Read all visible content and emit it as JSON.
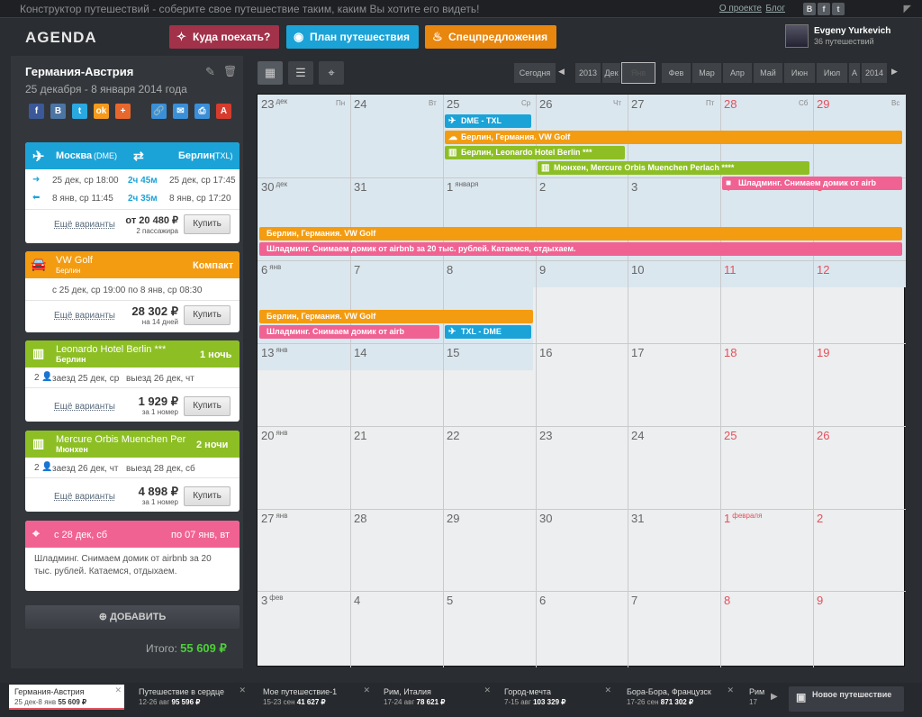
{
  "topbar": {
    "title": "Конструктор путешествий - соберите свое путешествие таким, каким Вы хотите его видеть!",
    "link_about": "О проекте",
    "link_blog": "Блог",
    "soc": [
      "В",
      "f",
      "t"
    ]
  },
  "header": {
    "logo": "AGENDA",
    "nav": [
      "Куда поехать?",
      "План путешествия",
      "Спецпредложения"
    ],
    "user_name": "Evgeny Yurkevich",
    "user_trips": "36 путешествий"
  },
  "trip": {
    "title": "Германия-Австрия",
    "dates": "25 декабря - 8 января 2014 года",
    "share": [
      "f",
      "B",
      "t",
      "ok",
      "+",
      "🔗",
      "✉",
      "⎙",
      "A"
    ]
  },
  "flight": {
    "from": "Москва",
    "from_code": "(DME)",
    "to": "Берлин",
    "to_code": "(TXL)",
    "leg1_dep": "25 дек, ср 18:00",
    "leg1_dur": "2ч 45м",
    "leg1_arr": "25 дек, ср 17:45",
    "leg2_dep": "8 янв, ср 11:45",
    "leg2_dur": "2ч 35м",
    "leg2_arr": "8 янв, ср 17:20",
    "more": "Ещё варианты",
    "price": "от 20 480 ₽",
    "price_sub": "2 пассажира",
    "buy": "Купить"
  },
  "car": {
    "name": "VW Golf",
    "city": "Берлин",
    "class": "Компакт",
    "period": "с 25 дек, ср 19:00 по 8 янв, ср 08:30",
    "more": "Ещё варианты",
    "price": "28 302 ₽",
    "price_sub": "на 14 дней",
    "buy": "Купить"
  },
  "hotel1": {
    "name": "Leonardo Hotel Berlin ***",
    "city": "Берлин",
    "nights": "1 ночь",
    "guests": "2",
    "checkin": "заезд 25 дек, ср",
    "checkout": "выезд 26 дек, чт",
    "more": "Ещё варианты",
    "price": "1 929 ₽",
    "price_sub": "за 1 номер",
    "buy": "Купить"
  },
  "hotel2": {
    "name": "Mercure Orbis Muenchen Per",
    "city": "Мюнхен",
    "nights": "2 ночи",
    "guests": "2",
    "checkin": "заезд 26 дек, чт",
    "checkout": "выезд 28 дек, сб",
    "more": "Ещё варианты",
    "price": "4 898 ₽",
    "price_sub": "за 1 номер",
    "buy": "Купить"
  },
  "rent": {
    "from": "с  28 дек, сб",
    "to": "по 07 янв, вт",
    "text": "Шладминг. Снимаем домик от airbnb за 20 тыс. рублей. Катаемся, отдыхаем."
  },
  "add_label": "ДОБАВИТЬ",
  "total_label": "Итого:",
  "total_value": "55 609 ₽",
  "calnav": {
    "today": "Сегодня",
    "year1": "2013",
    "months": [
      "Дек",
      "Янв",
      "Фев",
      "Мар",
      "Апр",
      "Май",
      "Июн",
      "Июл",
      "А"
    ],
    "year2": "2014",
    "prev": "◀",
    "next": "▶"
  },
  "weekdays": [
    "Пн",
    "Вт",
    "Ср",
    "Чт",
    "Пт",
    "Сб",
    "Вс"
  ],
  "weeks": [
    [
      [
        "23",
        "дек"
      ],
      [
        "24",
        ""
      ],
      [
        "25",
        ""
      ],
      [
        "26",
        ""
      ],
      [
        "27",
        ""
      ],
      [
        "28",
        ""
      ],
      [
        "29",
        ""
      ]
    ],
    [
      [
        "30",
        "дек"
      ],
      [
        "31",
        ""
      ],
      [
        "1",
        "января"
      ],
      [
        "2",
        ""
      ],
      [
        "3",
        ""
      ],
      [
        "4",
        ""
      ],
      [
        "5",
        ""
      ]
    ],
    [
      [
        "6",
        "янв"
      ],
      [
        "7",
        ""
      ],
      [
        "8",
        ""
      ],
      [
        "9",
        ""
      ],
      [
        "10",
        ""
      ],
      [
        "11",
        ""
      ],
      [
        "12",
        ""
      ]
    ],
    [
      [
        "13",
        "янв"
      ],
      [
        "14",
        ""
      ],
      [
        "15",
        ""
      ],
      [
        "16",
        ""
      ],
      [
        "17",
        ""
      ],
      [
        "18",
        ""
      ],
      [
        "19",
        ""
      ]
    ],
    [
      [
        "20",
        "янв"
      ],
      [
        "21",
        ""
      ],
      [
        "22",
        ""
      ],
      [
        "23",
        ""
      ],
      [
        "24",
        ""
      ],
      [
        "25",
        ""
      ],
      [
        "26",
        ""
      ]
    ],
    [
      [
        "27",
        "янв"
      ],
      [
        "28",
        ""
      ],
      [
        "29",
        ""
      ],
      [
        "30",
        ""
      ],
      [
        "31",
        ""
      ],
      [
        "1",
        "февраля"
      ],
      [
        "2",
        ""
      ]
    ],
    [
      [
        "3",
        "фев"
      ],
      [
        "4",
        ""
      ],
      [
        "5",
        ""
      ],
      [
        "6",
        ""
      ],
      [
        "7",
        ""
      ],
      [
        "8",
        ""
      ],
      [
        "9",
        ""
      ]
    ]
  ],
  "events": {
    "e1": "DME - TXL",
    "e2": "Берлин, Германия. VW Golf",
    "e3": "Берлин, Leonardo Hotel Berlin ***",
    "e4": "Мюнхен, Mercure Orbis Muenchen Perlach ****",
    "e5": "Шладминг. Снимаем домик от airb",
    "e6": "Берлин, Германия. VW Golf",
    "e7": "Шладминг. Снимаем домик от airbnb за 20 тыс. рублей. Катаемся, отдыхаем.",
    "e8": "Берлин, Германия. VW Golf",
    "e9": "Шладминг. Снимаем домик от airb",
    "e10": "TXL - DME"
  },
  "bottom": {
    "tabs": [
      {
        "title": "Германия-Австрия",
        "sub": "25 дек-8 янв",
        "price": "55 609 ₽"
      },
      {
        "title": "Путешествие в сердце",
        "sub": "12-26 авг",
        "price": "95 596 ₽"
      },
      {
        "title": "Мое путешествие-1",
        "sub": "15-23 сен",
        "price": "41 627 ₽"
      },
      {
        "title": "Рим, Италия",
        "sub": "17-24 авг",
        "price": "78 621 ₽"
      },
      {
        "title": "Город-мечта",
        "sub": "7-15 авг",
        "price": "103 329 ₽"
      },
      {
        "title": "Бора-Бора, Французск",
        "sub": "17-26 сен",
        "price": "871 302 ₽"
      },
      {
        "title": "Рим",
        "sub": "17",
        "price": ""
      }
    ],
    "new_trip": "Новое путешествие",
    "next": "▶"
  }
}
